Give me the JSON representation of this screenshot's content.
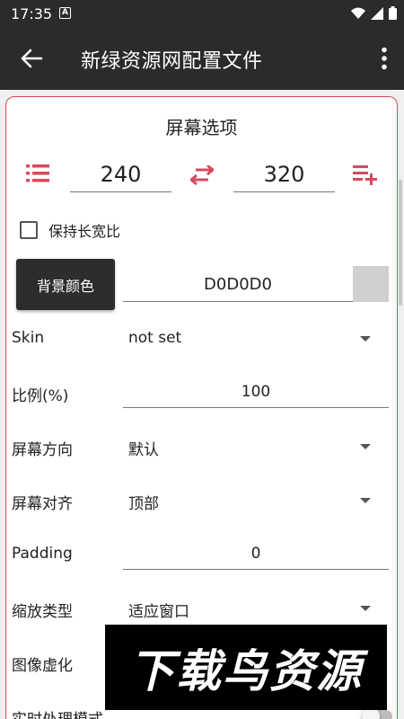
{
  "status_bar": {
    "time": "17:35",
    "notification_letter": "A"
  },
  "app_bar": {
    "title": "新绿资源网配置文件"
  },
  "section": {
    "title": "屏幕选项"
  },
  "dimensions": {
    "width": "240",
    "height": "320"
  },
  "keep_aspect": {
    "label": "保持长宽比",
    "checked": false
  },
  "background_color": {
    "button_label": "背景颜色",
    "value": "D0D0D0",
    "swatch_color": "#d0d0d0"
  },
  "settings": {
    "skin_label": "Skin",
    "skin_value": "not set",
    "scale_label": "比例(%)",
    "scale_value": "100",
    "orientation_label": "屏幕方向",
    "orientation_value": "默认",
    "align_label": "屏幕对齐",
    "align_value": "顶部",
    "padding_label": "Padding",
    "padding_value": "0",
    "scale_type_label": "缩放类型",
    "scale_type_value": "适应窗口",
    "image_blur_label": "图像虚化",
    "realtime_label": "实时处理模式"
  },
  "watermark": {
    "text": "下载鸟资源"
  },
  "colors": {
    "accent": "#d84a5e",
    "app_bar": "#2b2b2b",
    "card_border": "#d84a5e"
  }
}
